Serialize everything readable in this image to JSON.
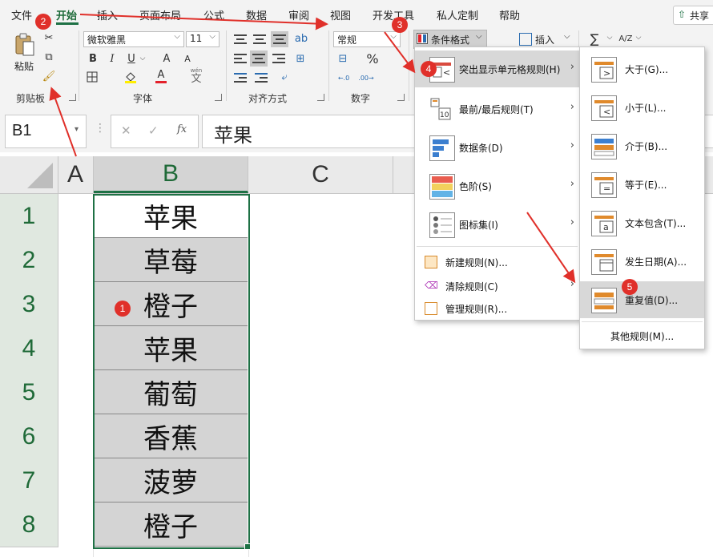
{
  "menu_tabs": [
    "文件",
    "开始",
    "插入",
    "页面布局",
    "公式",
    "数据",
    "审阅",
    "视图",
    "开发工具",
    "私人定制",
    "帮助"
  ],
  "share_label": "共享",
  "ribbon": {
    "paste_label": "粘贴",
    "clipboard_label": "剪贴板",
    "font_name": "微软雅黑",
    "font_size": "11",
    "bold": "B",
    "italic": "I",
    "underline": "U",
    "font_grow": "A",
    "font_shrink": "A",
    "font_color_letter": "A",
    "font_label": "字体",
    "alignment_label": "对齐方式",
    "number_format": "常规",
    "percent": "%",
    "number_label": "数字",
    "conditional_format": "条件格式",
    "insert_label": "插入",
    "sum_symbol": "∑",
    "sort_symbol": "A/Z",
    "wen_label": "wén",
    "wen_char": "文"
  },
  "formula_bar": {
    "name_box": "B1",
    "fx": "fx",
    "content": "苹果"
  },
  "columns": [
    "A",
    "B",
    "C"
  ],
  "rows": [
    {
      "num": "1",
      "value": "苹果"
    },
    {
      "num": "2",
      "value": "草莓"
    },
    {
      "num": "3",
      "value": "橙子"
    },
    {
      "num": "4",
      "value": "苹果"
    },
    {
      "num": "5",
      "value": "葡萄"
    },
    {
      "num": "6",
      "value": "香蕉"
    },
    {
      "num": "7",
      "value": "菠萝"
    },
    {
      "num": "8",
      "value": "橙子"
    }
  ],
  "cf_menu": {
    "items": [
      {
        "label": "突出显示单元格规则(H)",
        "has_sub": true
      },
      {
        "label": "最前/最后规则(T)",
        "has_sub": true
      },
      {
        "label": "数据条(D)",
        "has_sub": true
      },
      {
        "label": "色阶(S)",
        "has_sub": true
      },
      {
        "label": "图标集(I)",
        "has_sub": true
      }
    ],
    "small_items": [
      {
        "label": "新建规则(N)..."
      },
      {
        "label": "清除规则(C)",
        "has_sub": true
      },
      {
        "label": "管理规则(R)..."
      }
    ]
  },
  "highlight_submenu": {
    "items": [
      "大于(G)...",
      "小于(L)...",
      "介于(B)...",
      "等于(E)...",
      "文本包含(T)...",
      "发生日期(A)...",
      "重复值(D)..."
    ],
    "other": "其他规则(M)..."
  },
  "icon_glyphs": {
    "greater": ">",
    "less": "<",
    "equal": "=",
    "text": "a",
    "ten": "10"
  },
  "step_badges": [
    "1",
    "2",
    "3",
    "4",
    "5"
  ],
  "colors": {
    "accent": "#1e7145",
    "badge": "#e0302a",
    "selected_cell": "#d4d4d4",
    "menu_hover": "#d8d8d8"
  }
}
